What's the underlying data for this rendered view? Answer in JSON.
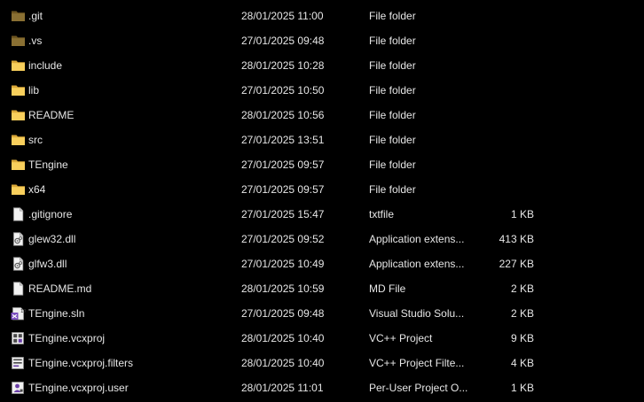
{
  "files": [
    {
      "name": ".git",
      "date": "28/01/2025 11:00",
      "type": "File folder",
      "size": "",
      "icon": "folder-hidden-icon"
    },
    {
      "name": ".vs",
      "date": "27/01/2025 09:48",
      "type": "File folder",
      "size": "",
      "icon": "folder-hidden-icon"
    },
    {
      "name": "include",
      "date": "28/01/2025 10:28",
      "type": "File folder",
      "size": "",
      "icon": "folder-icon"
    },
    {
      "name": "lib",
      "date": "27/01/2025 10:50",
      "type": "File folder",
      "size": "",
      "icon": "folder-icon"
    },
    {
      "name": "README",
      "date": "28/01/2025 10:56",
      "type": "File folder",
      "size": "",
      "icon": "folder-icon"
    },
    {
      "name": "src",
      "date": "27/01/2025 13:51",
      "type": "File folder",
      "size": "",
      "icon": "folder-icon"
    },
    {
      "name": "TEngine",
      "date": "27/01/2025 09:57",
      "type": "File folder",
      "size": "",
      "icon": "folder-icon"
    },
    {
      "name": "x64",
      "date": "27/01/2025 09:57",
      "type": "File folder",
      "size": "",
      "icon": "folder-icon"
    },
    {
      "name": ".gitignore",
      "date": "27/01/2025 15:47",
      "type": "txtfile",
      "size": "1 KB",
      "icon": "text-file-icon"
    },
    {
      "name": "glew32.dll",
      "date": "27/01/2025 09:52",
      "type": "Application extens...",
      "size": "413 KB",
      "icon": "dll-file-icon"
    },
    {
      "name": "glfw3.dll",
      "date": "27/01/2025 10:49",
      "type": "Application extens...",
      "size": "227 KB",
      "icon": "dll-file-icon"
    },
    {
      "name": "README.md",
      "date": "28/01/2025 10:59",
      "type": "MD File",
      "size": "2 KB",
      "icon": "text-file-icon"
    },
    {
      "name": "TEngine.sln",
      "date": "27/01/2025 09:48",
      "type": "Visual Studio Solu...",
      "size": "2 KB",
      "icon": "solution-file-icon"
    },
    {
      "name": "TEngine.vcxproj",
      "date": "28/01/2025 10:40",
      "type": "VC++ Project",
      "size": "9 KB",
      "icon": "vcxproj-file-icon"
    },
    {
      "name": "TEngine.vcxproj.filters",
      "date": "28/01/2025 10:40",
      "type": "VC++ Project Filte...",
      "size": "4 KB",
      "icon": "vcxproj-filters-file-icon"
    },
    {
      "name": "TEngine.vcxproj.user",
      "date": "28/01/2025 11:01",
      "type": "Per-User Project O...",
      "size": "1 KB",
      "icon": "vcxproj-user-file-icon"
    }
  ]
}
